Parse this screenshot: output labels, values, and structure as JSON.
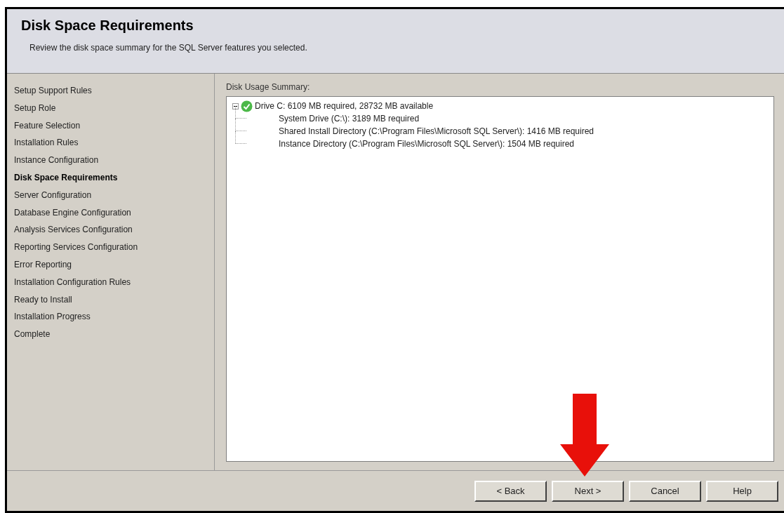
{
  "header": {
    "title": "Disk Space Requirements",
    "subtitle": "Review the disk space summary for the SQL Server features you selected."
  },
  "steps": [
    {
      "label": "Setup Support Rules",
      "selected": false
    },
    {
      "label": "Setup Role",
      "selected": false
    },
    {
      "label": "Feature Selection",
      "selected": false
    },
    {
      "label": "Installation Rules",
      "selected": false
    },
    {
      "label": "Instance Configuration",
      "selected": false
    },
    {
      "label": "Disk Space Requirements",
      "selected": true
    },
    {
      "label": "Server Configuration",
      "selected": false
    },
    {
      "label": "Database Engine Configuration",
      "selected": false
    },
    {
      "label": "Analysis Services Configuration",
      "selected": false
    },
    {
      "label": "Reporting Services Configuration",
      "selected": false
    },
    {
      "label": "Error Reporting",
      "selected": false
    },
    {
      "label": "Installation Configuration Rules",
      "selected": false
    },
    {
      "label": "Ready to Install",
      "selected": false
    },
    {
      "label": "Installation Progress",
      "selected": false
    },
    {
      "label": "Complete",
      "selected": false
    }
  ],
  "summary": {
    "label": "Disk Usage Summary:",
    "tree": [
      {
        "label": "Drive C: 6109 MB required, 28732 MB available",
        "expanded": true,
        "passed": true,
        "children": [
          {
            "label": "System Drive (C:\\): 3189 MB required"
          },
          {
            "label": "Shared Install Directory (C:\\Program Files\\Microsoft SQL Server\\): 1416 MB required"
          },
          {
            "label": "Instance Directory (C:\\Program Files\\Microsoft SQL Server\\): 1504 MB required"
          }
        ]
      }
    ]
  },
  "buttons": [
    "< Back",
    "Next >",
    "Cancel",
    "Help"
  ]
}
